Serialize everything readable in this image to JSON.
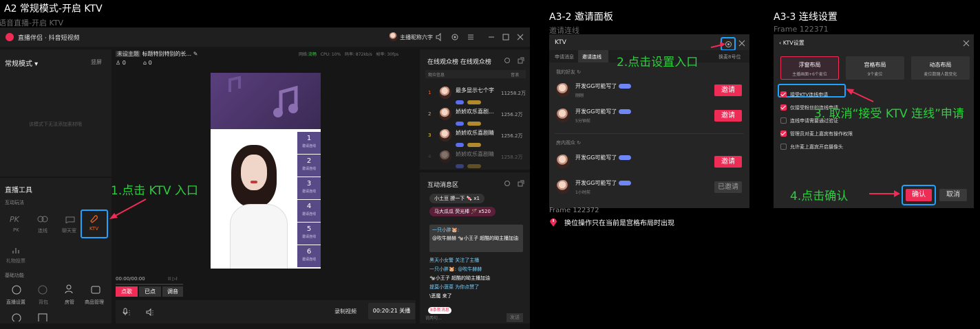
{
  "header": {
    "title": "A2 常规模式-开启 KTV",
    "subtitle": "语音直播-开启 KTV"
  },
  "app": {
    "name": "直播伴侣 · 抖音短视频",
    "host_name": "主播昵称六字"
  },
  "left": {
    "mode_label": "常规模式 ▾",
    "screen_label": "竖屏",
    "empty_hint": "该模式下无法添加素材哦",
    "tools_title": "直播工具",
    "interact_group": "互动玩法",
    "tools": [
      {
        "label": "PK",
        "icon": "pk-icon"
      },
      {
        "label": "连线",
        "icon": "link-icon"
      },
      {
        "label": "聊天室",
        "icon": "chatroom-icon"
      },
      {
        "label": "KTV",
        "icon": "mic-icon"
      }
    ],
    "gift_vote": "礼物投票",
    "basic_group": "基础功能",
    "basic_tools": [
      "直播设置",
      "背包",
      "房管",
      "商品管理"
    ]
  },
  "center": {
    "room_tag": "未设主题",
    "room_title": "标题特别特别的长...",
    "viewers": "0",
    "likes": "0",
    "net_label": "网络:",
    "net_value": "流畅",
    "cpu": "CPU: 10%",
    "bitrate": "码率: 872kb/s",
    "fps": "帧率: 30fps",
    "seats": [
      {
        "num": "1",
        "label": "邀请连线"
      },
      {
        "num": "2",
        "label": "邀请连线"
      },
      {
        "num": "3",
        "label": "邀请连线"
      },
      {
        "num": "4",
        "label": "邀请连线"
      },
      {
        "num": "5",
        "label": "邀请连线"
      },
      {
        "num": "6",
        "label": "邀请连线"
      }
    ],
    "song_time": "00:00/00:00",
    "song_tabs": [
      "点歌",
      "已点",
      "调音"
    ],
    "record_label": "录制视频",
    "duration": "00:20:21 关播"
  },
  "right": {
    "audience_title": "在线观众榜  在线观众榜",
    "col_info": "观众信息",
    "col_contrib": "音浪",
    "audience": [
      {
        "rank": "1",
        "name": "最多显示七个字",
        "value": "11258.2万"
      },
      {
        "rank": "2",
        "name": "娇娇欢乐喜剧...",
        "value": "1256.2万"
      },
      {
        "rank": "3",
        "name": "娇娇欢乐喜剧睛",
        "value": "1256.2万"
      },
      {
        "rank": "4",
        "name": "娇娇欢乐喜剧睛",
        "value": "1258.2万"
      }
    ],
    "msg_title": "互动消息区",
    "gift1": "小土豆  撩一下 🍬  x1",
    "gift2": "马大瓜瓜  荧光棒 🪄  x520",
    "quote_name": "一只小胖🐹:",
    "quote_text": "@吹牛赫赫  🐄小王子  超酷的呦主播加油",
    "messages": [
      "黑天小女警  关注了主播",
      "一只小胖🐹:  @吹牛赫赫",
      "🐄小王子  超酷的呦主播加油",
      "提莫小菠菜  为你点赞了",
      "\\恶魔  来了"
    ],
    "new_msgs": "8条新消息",
    "input_placeholder": "说两句...",
    "send_label": "发送"
  },
  "annotations": {
    "step1": "1.点击 KTV 入口",
    "step2": "2.点击设置入口",
    "step3": "3. 取消“接受 KTV 连线”申请",
    "step4": "4.点击确认"
  },
  "invite": {
    "title": "A3-2 邀请面板",
    "subtitle": "邀请连线",
    "panel_title": "KTV",
    "tabs": [
      "申请消息",
      "邀请连线"
    ],
    "right_tab": "换麦8号位",
    "friends_label": "我的好友",
    "room_label": "房内观众",
    "rows": [
      {
        "name": "开发GG可能写了",
        "time": "刚刚",
        "action": "邀请"
      },
      {
        "name": "开发GG可能写了",
        "time": "5分钟前",
        "action": "邀请"
      },
      {
        "name": "开发GG可能写了",
        "time": "",
        "action": "邀请"
      },
      {
        "name": "开发GG可能写了",
        "time": "1小时前",
        "action": "已邀请"
      }
    ],
    "frame_label": "Frame 122372",
    "note": "换位操作只在当前是宫格布局时出现"
  },
  "settings": {
    "title": "A3-3 连线设置",
    "subtitle": "Frame 122371",
    "panel_title": "KTV设置",
    "layouts": [
      {
        "name": "浮窗布局",
        "desc": "主播画面+6个麦位"
      },
      {
        "name": "宫格布局",
        "desc": "9个麦位"
      },
      {
        "name": "动态布局",
        "desc": "麦位数随人数变化"
      }
    ],
    "options": [
      {
        "label": "接受KTV连线申请",
        "on": true
      },
      {
        "label": "仅接受粉丝的连线申请",
        "on": true
      },
      {
        "label": "连线申请需要通过验证",
        "on": false
      },
      {
        "label": "管理员对麦上嘉宾有操作权限",
        "on": true
      },
      {
        "label": "允许麦上嘉宾开启摄像头",
        "on": false
      }
    ],
    "confirm": "确认",
    "cancel": "取消"
  },
  "colors": {
    "accent": "#ef2c55",
    "annotation": "#2bd13c",
    "highlight": "#1ea3ff"
  }
}
